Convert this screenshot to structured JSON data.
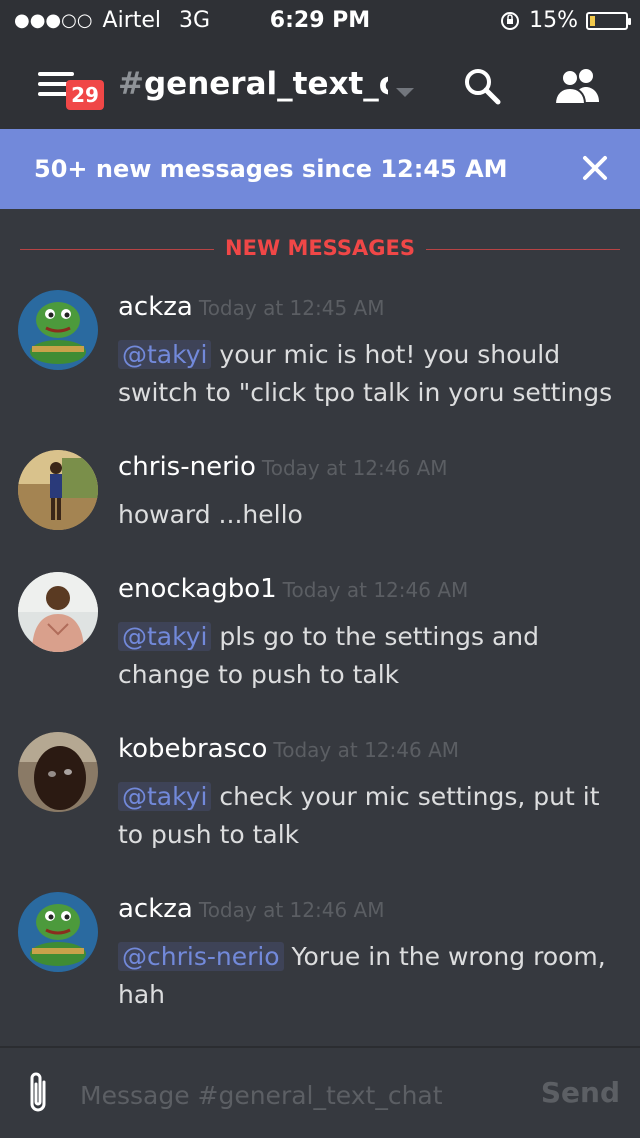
{
  "status_bar": {
    "signal": "●●●○○",
    "carrier": "Airtel",
    "network": "3G",
    "time": "6:29 PM",
    "battery": "15%",
    "battery_level": 0.15
  },
  "header": {
    "badge_count": "29",
    "hash": "#",
    "channel_name": "general_text_c..."
  },
  "banner": {
    "text": "50+ new messages since 12:45 AM"
  },
  "divider": {
    "label": "NEW MESSAGES"
  },
  "messages": [
    {
      "username": "ackza",
      "timestamp": "Today at 12:45 AM",
      "mention": "@takyi",
      "text": " your mic is hot! you should switch to \"click tpo talk in yoru settings"
    },
    {
      "username": "chris-nerio",
      "timestamp": "Today at 12:46 AM",
      "mention": "",
      "text": "howard ...hello"
    },
    {
      "username": "enockagbo1",
      "timestamp": "Today at 12:46 AM",
      "mention": "@takyi",
      "text": "  pls go to the settings and change to push to talk"
    },
    {
      "username": "kobebrasco",
      "timestamp": "Today at 12:46 AM",
      "mention": "@takyi",
      "text": " check your mic settings, put it to push to talk"
    },
    {
      "username": "ackza",
      "timestamp": "Today at 12:46 AM",
      "mention": "@chris-nerio",
      "text": " Yorue in the wrong room, hah"
    }
  ],
  "composer": {
    "placeholder": "Message #general_text_chat",
    "send_label": "Send"
  },
  "colors": {
    "background": "#36393f",
    "header": "#2f3136",
    "banner": "#7289da",
    "accent_red": "#f04747",
    "mention": "#7289da"
  },
  "icons": {
    "menu": "hamburger-icon",
    "search": "search-icon",
    "members": "members-icon",
    "close": "close-icon",
    "attach": "paperclip-icon",
    "dropdown": "chevron-down-icon"
  }
}
